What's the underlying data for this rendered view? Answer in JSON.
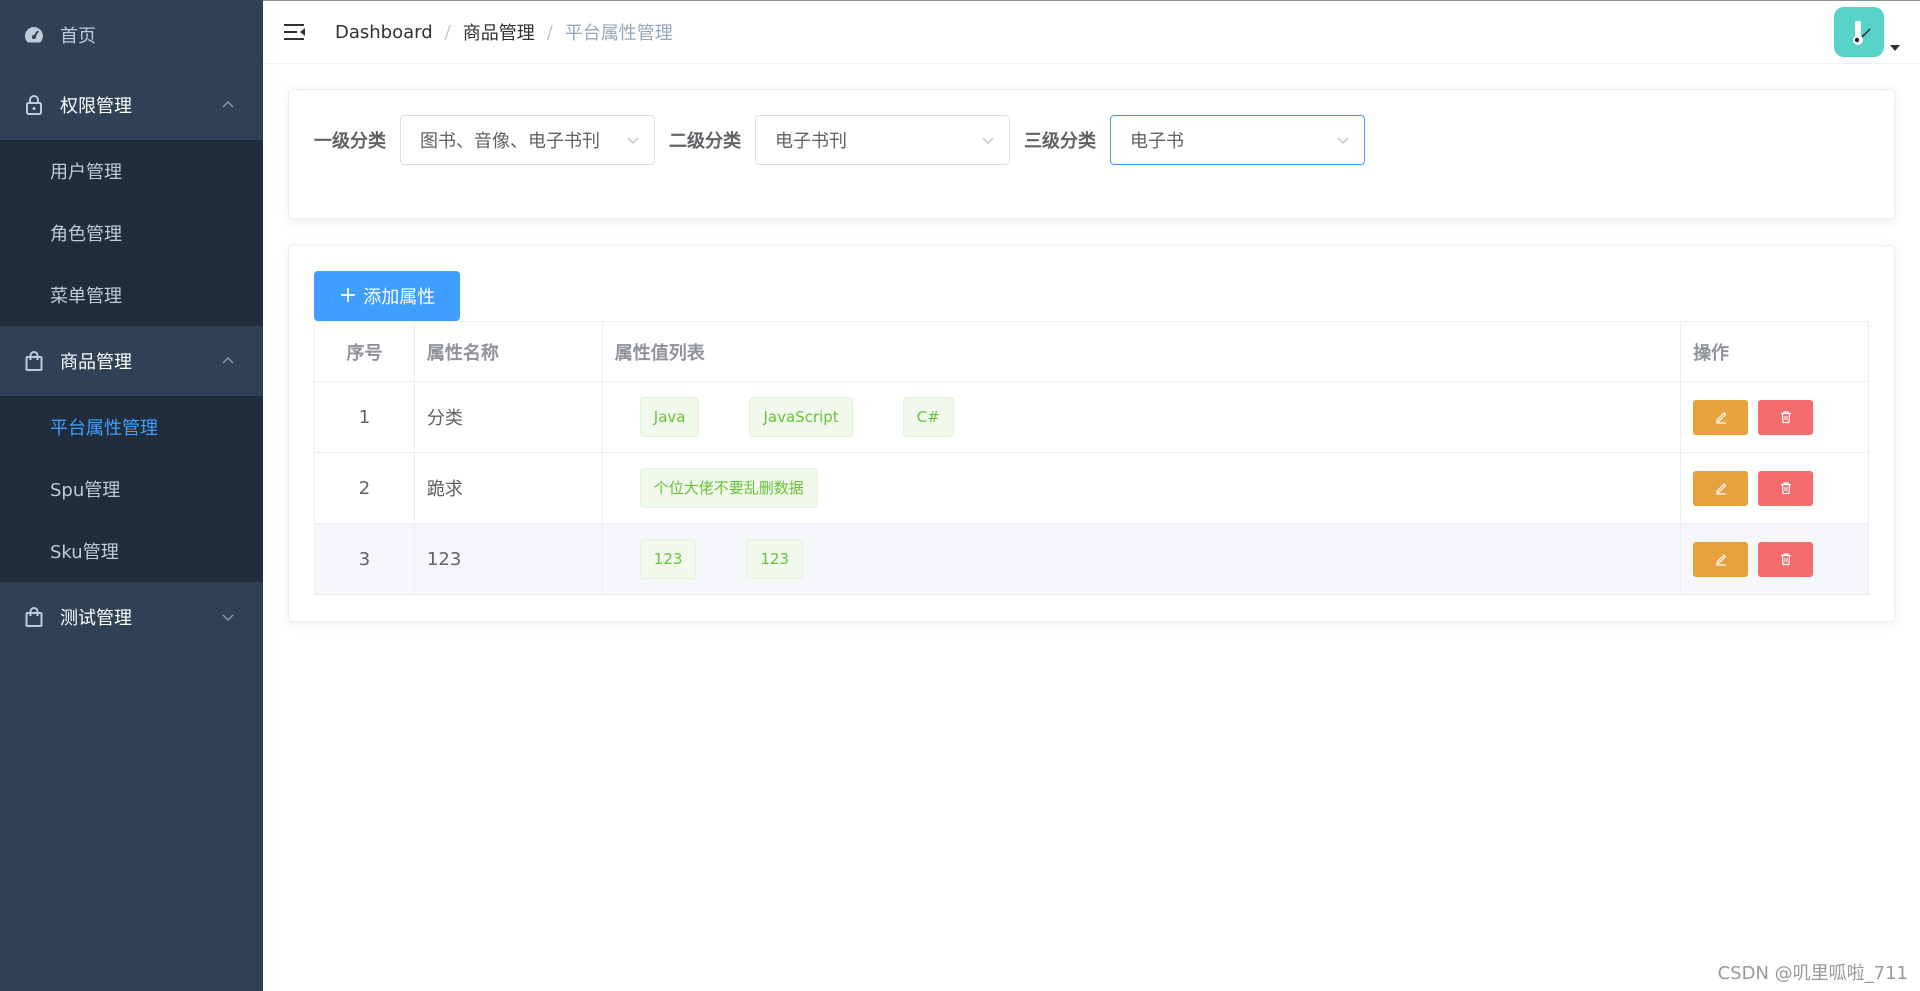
{
  "colors": {
    "sidebar_bg": "#304156",
    "submenu_bg": "#1f2d3d",
    "primary": "#409eff",
    "warning": "#e6a23c",
    "danger": "#f56c6c",
    "success": "#67c23a"
  },
  "sidebar": {
    "home": {
      "label": "首页",
      "icon": "dashboard-icon"
    },
    "permission": {
      "label": "权限管理",
      "icon": "lock-icon",
      "expanded": true,
      "items": [
        {
          "label": "用户管理"
        },
        {
          "label": "角色管理"
        },
        {
          "label": "菜单管理"
        }
      ]
    },
    "product": {
      "label": "商品管理",
      "icon": "shopping-bag-icon",
      "expanded": true,
      "items": [
        {
          "label": "平台属性管理",
          "active": true
        },
        {
          "label": "Spu管理"
        },
        {
          "label": "Sku管理"
        }
      ]
    },
    "test": {
      "label": "测试管理",
      "icon": "shopping-bag-icon",
      "expanded": false
    }
  },
  "header": {
    "breadcrumb": [
      "Dashboard",
      "商品管理",
      "平台属性管理"
    ],
    "breadcrumb_sep": "/"
  },
  "filters": {
    "c1": {
      "label": "一级分类",
      "value": "图书、音像、电子书刊"
    },
    "c2": {
      "label": "二级分类",
      "value": "电子书刊"
    },
    "c3": {
      "label": "三级分类",
      "value": "电子书"
    }
  },
  "toolbar": {
    "add_label": "添加属性"
  },
  "table": {
    "headers": {
      "index": "序号",
      "name": "属性名称",
      "values": "属性值列表",
      "ops": "操作"
    },
    "rows": [
      {
        "index": "1",
        "name": "分类",
        "values": [
          "Java",
          "JavaScript",
          "C#"
        ]
      },
      {
        "index": "2",
        "name": "跪求",
        "values": [
          "个位大佬不要乱删数据"
        ]
      },
      {
        "index": "3",
        "name": "123",
        "values": [
          "123",
          "123"
        ]
      }
    ]
  },
  "watermark": "CSDN @叽里呱啦_711"
}
